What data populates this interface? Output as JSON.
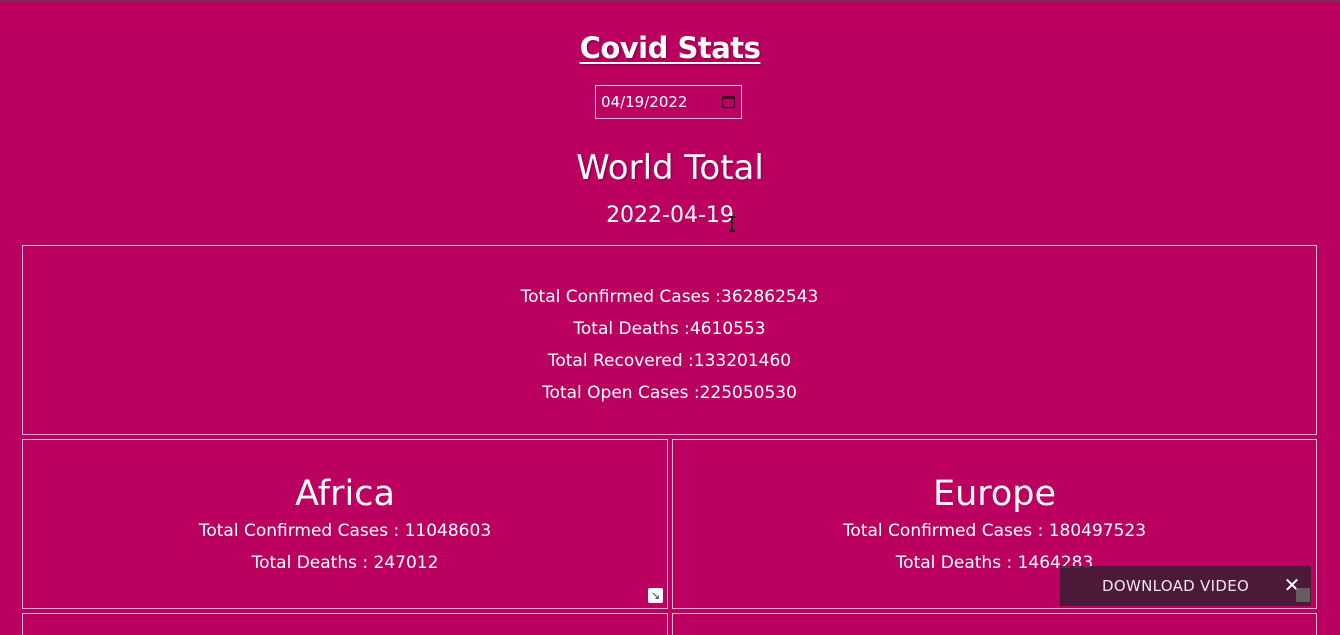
{
  "page": {
    "title": "Covid Stats",
    "date_value": "04/19/2022"
  },
  "world": {
    "heading": "World Total",
    "date": "2022-04-19",
    "stats": {
      "confirmed": "Total Confirmed Cases :362862543",
      "deaths": "Total Deaths :4610553",
      "recovered": "Total Recovered :133201460",
      "open": "Total Open Cases :225050530"
    }
  },
  "continents": [
    {
      "name": "Africa",
      "confirmed": "Total Confirmed Cases : 11048603",
      "deaths": "Total Deaths : 247012"
    },
    {
      "name": "Europe",
      "confirmed": "Total Confirmed Cases : 180497523",
      "deaths": "Total Deaths : 1464283"
    }
  ],
  "overlay": {
    "download_label": "DOWNLOAD VIDEO",
    "close_glyph": "✕",
    "resize_glyph": "↘"
  },
  "icons": {
    "calendar": "calendar-icon",
    "close": "close-icon",
    "resize": "resize-icon"
  },
  "colors": {
    "background": "#bb0060",
    "text": "#ffffff",
    "border": "#e6b3cc",
    "overlay": "#3c1e32"
  }
}
